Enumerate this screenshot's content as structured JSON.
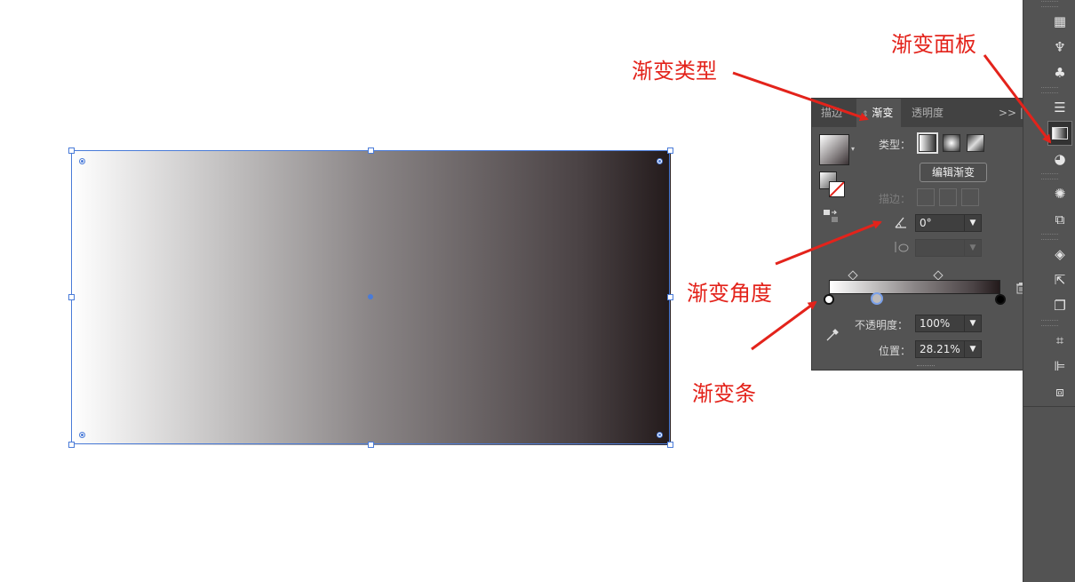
{
  "canvas": {
    "gradient_colors": [
      "#ffffff",
      "#bdbbbb",
      "#8a8586",
      "#4a4244",
      "#231a1b"
    ],
    "selection_color": "#4a7bd8"
  },
  "panel": {
    "tabs": {
      "stroke": "描边",
      "gradient": "渐变",
      "transparency": "透明度",
      "more": ">>  |  ≡"
    },
    "type_label": "类型：",
    "edit_gradient_label": "编辑渐变",
    "stroke_label": "描边：",
    "angle_value": "0°",
    "opacity_label": "不透明度：",
    "opacity_value": "100%",
    "location_label": "位置：",
    "location_value": "28.21%",
    "stops": [
      {
        "position": 0,
        "color": "#ffffff"
      },
      {
        "position": 28.21,
        "color": "#bdbbbb"
      },
      {
        "position": 100,
        "color": "#000000"
      }
    ],
    "trash_icon": "trash-icon",
    "eyedropper_icon": "eyedropper-icon"
  },
  "annotations": {
    "gradient_type": "渐变类型",
    "gradient_panel": "渐变面板",
    "gradient_angle": "渐变角度",
    "gradient_bar": "渐变条",
    "color": "#e3231b"
  },
  "dock": {
    "icons": [
      "libraries-icon",
      "symbols-brush-icon",
      "club-icon",
      "stroke-lines-icon",
      "gradient-icon",
      "transparency-icon",
      "appearance-icon",
      "graphic-styles-icon",
      "layers-icon",
      "export-icon",
      "artboards-icon",
      "transform-icon",
      "align-icon",
      "pathfinder-icon"
    ]
  }
}
